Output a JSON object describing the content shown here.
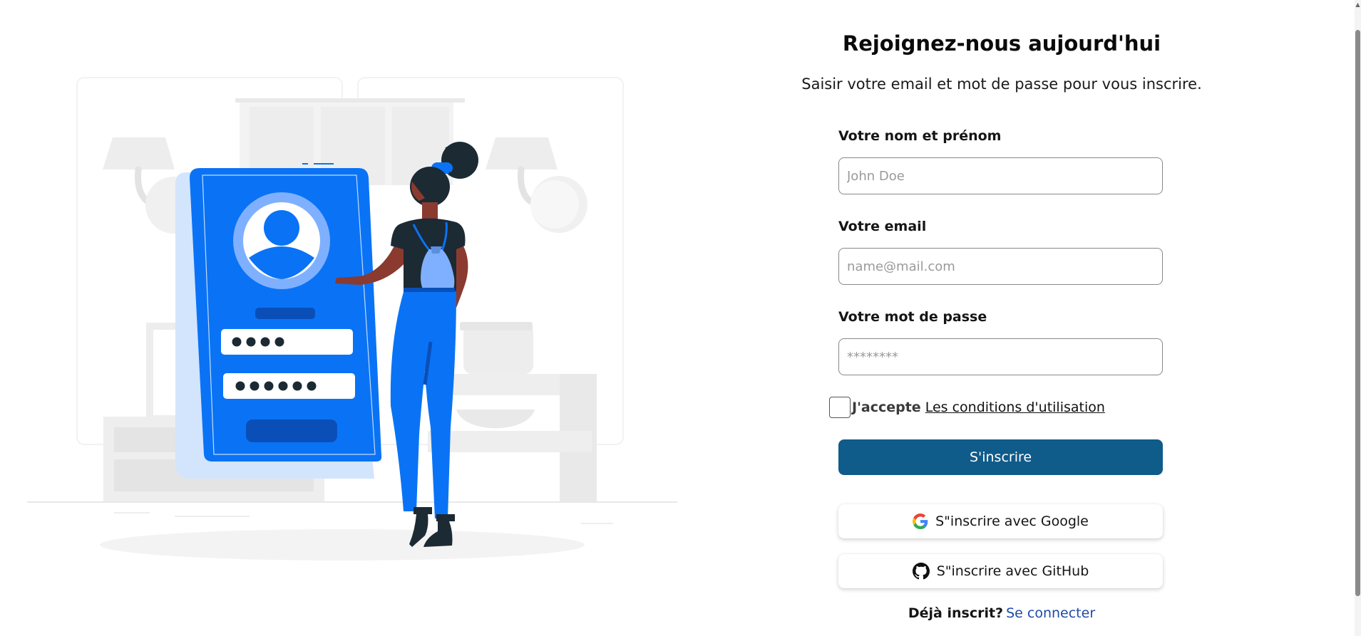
{
  "form": {
    "title": "Rejoignez-nous aujourd'hui",
    "subtitle": "Saisir votre email et mot de passe pour vous inscrire.",
    "name_label": "Votre nom et prénom",
    "name_placeholder": "John Doe",
    "name_value": "",
    "email_label": "Votre email",
    "email_placeholder": "name@mail.com",
    "email_value": "",
    "password_label": "Votre mot de passe",
    "password_placeholder": "********",
    "password_value": "",
    "terms_checked": false,
    "terms_prefix": "J'accepte",
    "terms_link": "Les conditions d'utilisation",
    "submit_label": "S'inscrire",
    "google_label": "S\"inscrire avec Google",
    "github_label": "S\"inscrire avec GitHub",
    "login_prefix": "Déjà inscrit?",
    "login_link": "Se connecter"
  },
  "icons": {
    "google": "google-icon",
    "github": "github-icon",
    "illustration": "sign-up-illustration"
  },
  "colors": {
    "primary_button": "#0f5b8a",
    "link": "#1f4aa8",
    "illustration_blue": "#0a73f5",
    "illustration_dark": "#1c2a33",
    "illustration_light_blue": "#7fb0ff"
  }
}
